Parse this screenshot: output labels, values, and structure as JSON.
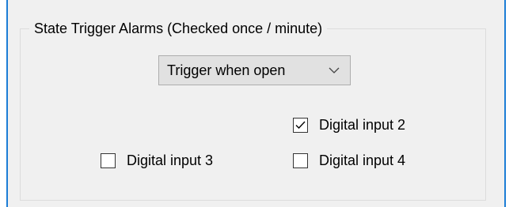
{
  "group": {
    "title": "State Trigger Alarms (Checked once / minute)"
  },
  "trigger_select": {
    "value": "Trigger when open",
    "icon": "chevron-down-icon"
  },
  "inputs": [
    {
      "label": "Digital input 2",
      "checked": true
    },
    {
      "label": "Digital input 3",
      "checked": false
    },
    {
      "label": "Digital input 4",
      "checked": false
    }
  ],
  "colors": {
    "window_border": "#1c7dd6",
    "dialog_background": "#f0f0f0",
    "dropdown_background": "#e1e1e1"
  }
}
